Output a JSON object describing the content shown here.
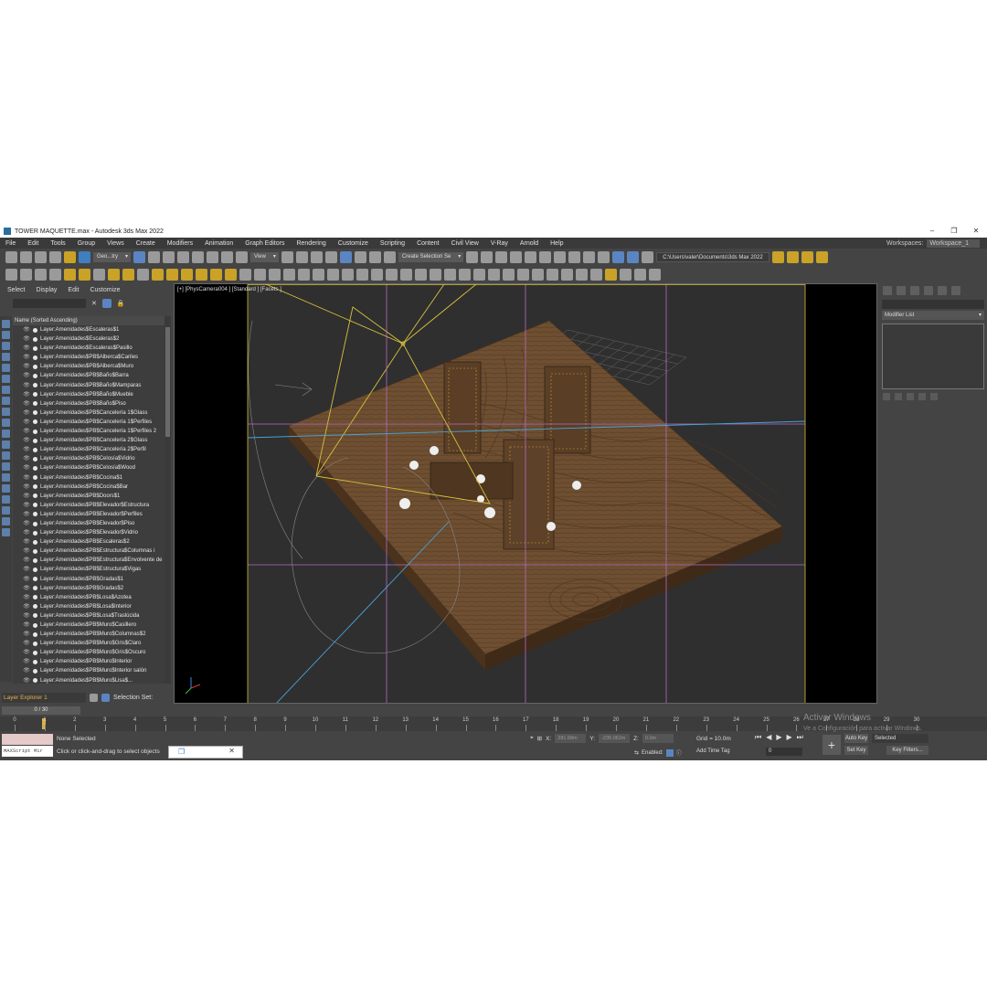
{
  "window": {
    "title": "TOWER MAQUETTE.max - Autodesk 3ds Max 2022",
    "controls": [
      "–",
      "❐",
      "✕"
    ]
  },
  "menu": {
    "items": [
      "File",
      "Edit",
      "Tools",
      "Group",
      "Views",
      "Create",
      "Modifiers",
      "Animation",
      "Graph Editors",
      "Rendering",
      "Customize",
      "Scripting",
      "Content",
      "Civil View",
      "V-Ray",
      "Arnold",
      "Help"
    ],
    "workspaces_label": "Workspaces:",
    "workspace_value": "Workspace_1"
  },
  "toolbar": {
    "filter_dropdown": "Geo...try",
    "refcoord_dropdown": "View",
    "selection_set": "Create Selection Se",
    "project_path": "C:\\Users\\valer\\Documents\\3ds Max 2022"
  },
  "scene_explorer": {
    "menu": [
      "Select",
      "Display",
      "Edit",
      "Customize"
    ],
    "column_header": "Name (Sorted Ascending)",
    "layers": [
      "Layer:Amenidades$Escaleras$1",
      "Layer:Amenidades$Escaleras$2",
      "Layer:Amenidades$Escaleras$Pasillo",
      "Layer:Amenidades$PB$Alberca$Cariles",
      "Layer:Amenidades$PB$Alberca$Muro",
      "Layer:Amenidades$PB$Baño$Barra",
      "Layer:Amenidades$PB$Baño$Mamparas",
      "Layer:Amenidades$PB$Baño$Mueble",
      "Layer:Amenidades$PB$Baño$Piso",
      "Layer:Amenidades$PB$Cancelería 1$Glass",
      "Layer:Amenidades$PB$Cancelería 1$Perfiles",
      "Layer:Amenidades$PB$Cancelería 1$Perfiles 2",
      "Layer:Amenidades$PB$Cancelería 2$Glass",
      "Layer:Amenidades$PB$Cancelería 2$Perfil",
      "Layer:Amenidades$PB$Celosía$Vidrio",
      "Layer:Amenidades$PB$Celosía$Wood",
      "Layer:Amenidades$PB$Cocina$1",
      "Layer:Amenidades$PB$Cocina$Bar",
      "Layer:Amenidades$PB$Doors$1",
      "Layer:Amenidades$PB$Elevador$Estructura",
      "Layer:Amenidades$PB$Elevador$Perfiles",
      "Layer:Amenidades$PB$Elevador$Piso",
      "Layer:Amenidades$PB$Elevador$Vidrio",
      "Layer:Amenidades$PB$Escaleras$2",
      "Layer:Amenidades$PB$Estructura$Columnas i",
      "Layer:Amenidades$PB$Estructura$Envolvente de",
      "Layer:Amenidades$PB$Estructura$Vigas",
      "Layer:Amenidades$PB$Gradas$1",
      "Layer:Amenidades$PB$Gradas$2",
      "Layer:Amenidades$PB$Losa$Azotea",
      "Layer:Amenidades$PB$Losa$Interior",
      "Layer:Amenidades$PB$Losa$Traslúcida",
      "Layer:Amenidades$PB$Muro$Casillero",
      "Layer:Amenidades$PB$Muro$Columnas$2",
      "Layer:Amenidades$PB$Muro$Gris$Claro",
      "Layer:Amenidades$PB$Muro$Gris$Oscuro",
      "Layer:Amenidades$PB$Muro$Interior",
      "Layer:Amenidades$PB$Muro$Interior salón",
      "Layer:Amenidades$PB$Muro$Lisa$..."
    ],
    "layer_explorer_label": "Layer Explorer 1",
    "selection_set_label": "Selection Set:"
  },
  "viewport": {
    "label": "[+] [PhysCamera004 ] [Standard ] [Facets ]"
  },
  "command_panel": {
    "modifier_list": "Modifier List"
  },
  "timeline": {
    "frame_display": "0 / 30",
    "ticks": [
      "0",
      "1",
      "2",
      "3",
      "4",
      "5",
      "6",
      "7",
      "8",
      "9",
      "10",
      "11",
      "12",
      "13",
      "14",
      "15",
      "16",
      "17",
      "18",
      "19",
      "20",
      "21",
      "22",
      "23",
      "24",
      "25",
      "26",
      "27",
      "28",
      "29",
      "30"
    ]
  },
  "status": {
    "maxscript_label": "MAXScript Mir",
    "selection": "None Selected",
    "prompt": "Click or click-and-drag to select objects",
    "x_label": "X:",
    "x_value": "281.68m",
    "y_label": "Y:",
    "y_value": "-235.062m",
    "z_label": "Z:",
    "z_value": "0.0m",
    "grid": "Grid = 10.0m",
    "enabled_label": "Enabled:",
    "add_time_tag": "Add Time Tag",
    "current_frame": "0",
    "auto_key": "Auto Key",
    "set_key": "Set Key",
    "key_mode": "Selected",
    "key_filters": "Key Filters..."
  },
  "watermark": {
    "line1": "Activar Windows",
    "line2": "Ve a Configuración para activar Windows."
  }
}
